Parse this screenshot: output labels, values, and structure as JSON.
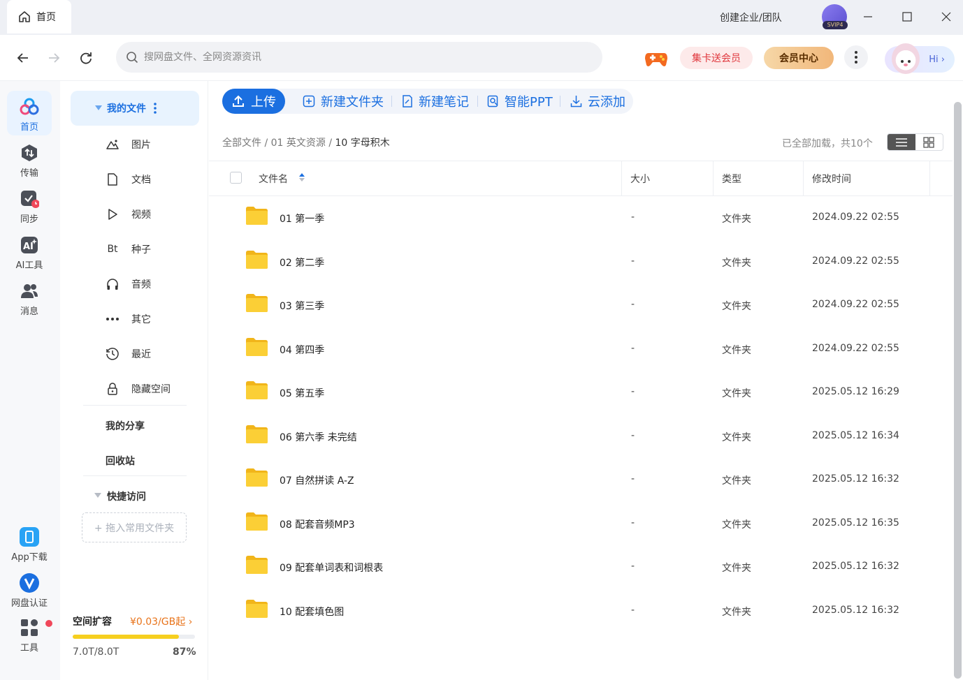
{
  "window": {
    "tab_label": "首页",
    "corp_label": "创建企业/团队",
    "vip_badge": "SVIP4"
  },
  "toolbar": {
    "search_placeholder": "搜网盘文件、全网资源资讯",
    "jika_label": "集卡送会员",
    "vip_center_label": "会员中心",
    "hi_label": "Hi"
  },
  "left_nav": [
    {
      "label": "首页",
      "icon": "cloud-logo-icon",
      "active": true
    },
    {
      "label": "传输",
      "icon": "transfer-icon"
    },
    {
      "label": "同步",
      "icon": "sync-icon"
    },
    {
      "label": "AI工具",
      "icon": "ai-tools-icon"
    },
    {
      "label": "消息",
      "icon": "message-icon"
    }
  ],
  "left_nav_bottom": [
    {
      "label": "App下载",
      "icon": "app-download-icon"
    },
    {
      "label": "网盘认证",
      "icon": "verify-icon"
    },
    {
      "label": "工具",
      "icon": "tools-icon"
    }
  ],
  "sidebar": {
    "my_files": "我的文件",
    "items": [
      {
        "label": "图片",
        "icon": "image-icon"
      },
      {
        "label": "文档",
        "icon": "document-icon"
      },
      {
        "label": "视频",
        "icon": "video-icon"
      },
      {
        "label": "种子",
        "icon": "torrent-icon",
        "glyph": "Bt"
      },
      {
        "label": "音频",
        "icon": "headphones-icon"
      },
      {
        "label": "其它",
        "icon": "more-dots-icon"
      },
      {
        "label": "最近",
        "icon": "recent-icon"
      },
      {
        "label": "隐藏空间",
        "icon": "lock-icon"
      }
    ],
    "my_share": "我的分享",
    "recycle": "回收站",
    "quick_access": "快捷访问",
    "drop_hint": "+ 拖入常用文件夹",
    "storage": {
      "title": "空间扩容",
      "price": "¥0.03/GB起",
      "used": "7.0T/8.0T",
      "percent_label": "87%",
      "fraction": 0.87
    }
  },
  "actions": {
    "upload": "上传",
    "new_folder": "新建文件夹",
    "new_note": "新建笔记",
    "smart_ppt": "智能PPT",
    "cloud_add": "云添加"
  },
  "breadcrumb": {
    "root": "全部文件",
    "sep": "/",
    "mid": "01 英文资源",
    "current": "10 字母积木"
  },
  "loaded_text": "已全部加载，共10个",
  "table": {
    "headers": {
      "name": "文件名",
      "size": "大小",
      "type": "类型",
      "time": "修改时间"
    },
    "rows": [
      {
        "name": "01 第一季",
        "size": "-",
        "type": "文件夹",
        "time": "2024.09.22 02:55"
      },
      {
        "name": "02 第二季",
        "size": "-",
        "type": "文件夹",
        "time": "2024.09.22 02:55"
      },
      {
        "name": "03 第三季",
        "size": "-",
        "type": "文件夹",
        "time": "2024.09.22 02:55"
      },
      {
        "name": "04 第四季",
        "size": "-",
        "type": "文件夹",
        "time": "2024.09.22 02:55"
      },
      {
        "name": "05 第五季",
        "size": "-",
        "type": "文件夹",
        "time": "2025.05.12 16:29"
      },
      {
        "name": "06 第六季 未完结",
        "size": "-",
        "type": "文件夹",
        "time": "2025.05.12 16:34"
      },
      {
        "name": "07 自然拼读 A-Z",
        "size": "-",
        "type": "文件夹",
        "time": "2025.05.12 16:32"
      },
      {
        "name": "08 配套音频MP3",
        "size": "-",
        "type": "文件夹",
        "time": "2025.05.12 16:35"
      },
      {
        "name": "09 配套单词表和词根表",
        "size": "-",
        "type": "文件夹",
        "time": "2025.05.12 16:32"
      },
      {
        "name": "10 配套填色图",
        "size": "-",
        "type": "文件夹",
        "time": "2025.05.12 16:32"
      }
    ]
  },
  "colors": {
    "accent": "#1b6fe0",
    "folder": "#f9c51f",
    "storage_bar": "#f6cf1f",
    "price": "#e8731a"
  }
}
